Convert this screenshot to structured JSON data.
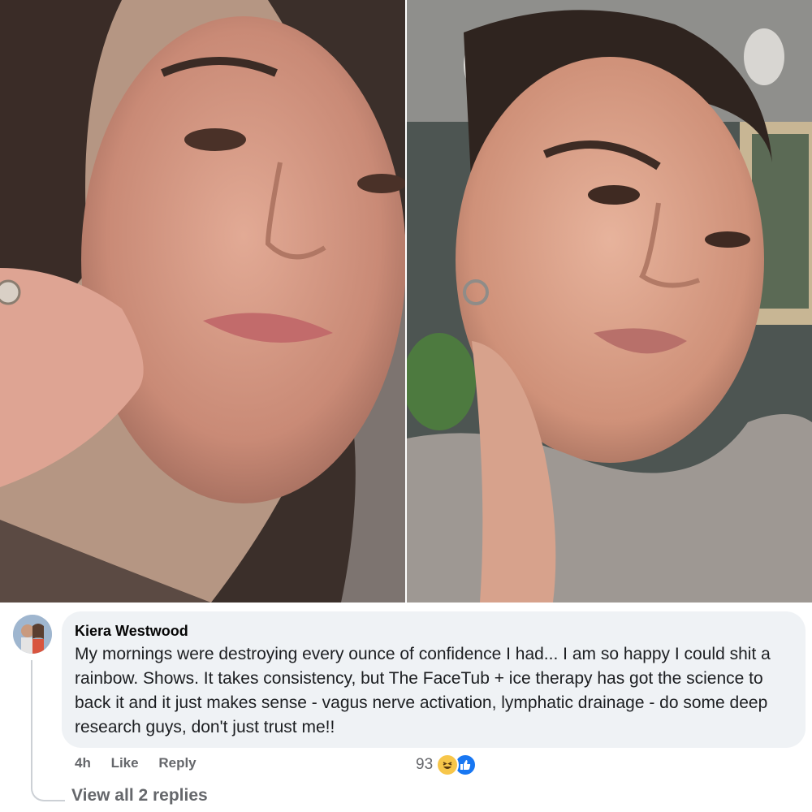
{
  "comment": {
    "author": "Kiera Westwood",
    "text": "My mornings were destroying every ounce of confidence I had... I am so happy I could shit a rainbow. Shows. It takes consistency, but The FaceTub + ice therapy has got the science to back it and it just makes sense - vagus nerve activation, lymphatic drainage - do some deep research guys, don't just trust me!!",
    "time": "4h",
    "like_label": "Like",
    "reply_label": "Reply",
    "reaction_count": "93",
    "reaction_icons": [
      "haha-icon",
      "like-icon"
    ],
    "view_replies_label": "View all 2 replies"
  },
  "colors": {
    "bubble": "#eff2f5",
    "secondary_text": "#65676b",
    "like_blue": "#1877f2",
    "haha_yellow": "#f7c64a"
  }
}
